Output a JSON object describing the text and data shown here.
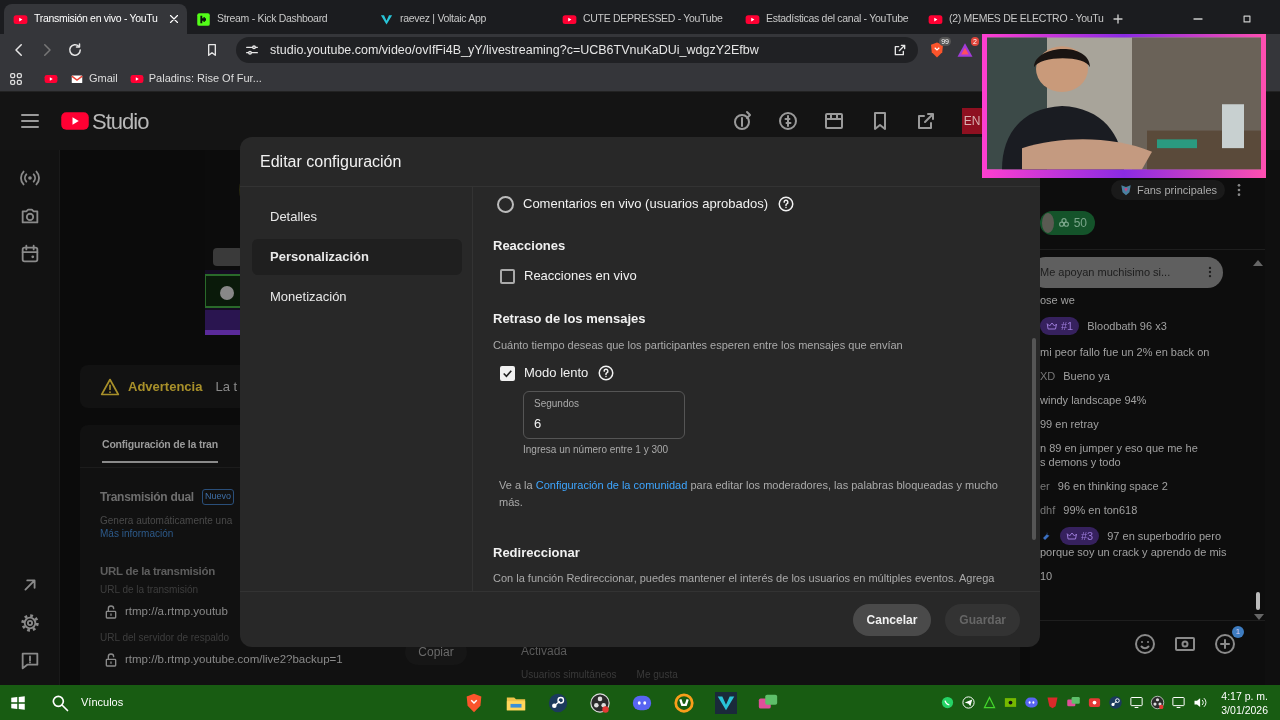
{
  "browser": {
    "tabs": [
      {
        "label": "Transmisión en vivo - YouTu",
        "selected": true
      },
      {
        "label": "Stream - Kick Dashboard",
        "selected": false
      },
      {
        "label": "raevez | Voltaic App",
        "selected": false
      },
      {
        "label": "CUTE DEPRESSED - YouTube",
        "selected": false
      },
      {
        "label": "Estadísticas del canal - YouTube",
        "selected": false
      },
      {
        "label": "(2) MEMES DE ELECTRO - YouTu",
        "selected": false
      }
    ],
    "forward_disabled": true,
    "url": "studio.youtube.com/video/ovIfFi4B_yY/livestreaming?c=UCB6TVnuKaDUi_wdgzY2Efbw",
    "extensions": [
      {
        "badge": "99"
      },
      {
        "badge": "2"
      }
    ],
    "bookmarks": [
      {
        "label": "Gmail"
      },
      {
        "label": "Paladins: Rise Of Fur..."
      }
    ]
  },
  "studio": {
    "logo": "Studio",
    "language_badge": "EN",
    "warning": {
      "title": "Advertencia",
      "text": "La t"
    },
    "config": {
      "tab": "Configuración de la tran",
      "dual_title": "Transmisión dual",
      "dual_badge": "Nuevo",
      "dual_text": "Genera automáticamente una",
      "dual_link": "Más información",
      "url_heading": "URL de la transmisión",
      "fields": [
        {
          "label": "URL de la transmisión",
          "value": "rtmp://a.rtmp.youtub"
        },
        {
          "label": "URL del servidor de respaldo",
          "value": "rtmp://b.rtmp.youtube.com/live2?backup=1"
        }
      ],
      "copy_button": "Copiar",
      "status": "Activada",
      "stat_labels": [
        "Usuarios simultáneos",
        "Me gusta"
      ]
    }
  },
  "chat": {
    "top_fans": "Fans principales",
    "fan_count": "50",
    "pinned": "Me apoyan muchisimo si...",
    "action_badge": "1",
    "messages": [
      {
        "lines": [
          "ose we"
        ],
        "moderator": false
      },
      {
        "badge": "#1",
        "lines": [
          "Bloodbath 96 x3"
        ],
        "moderator": false
      },
      {
        "lines": [
          "mi peor fallo fue un 2% en back on"
        ],
        "moderator": false
      },
      {
        "author": "XD",
        "lines": [
          "Bueno ya"
        ],
        "moderator": false
      },
      {
        "lines": [
          "windy landscape 94%"
        ],
        "moderator": false
      },
      {
        "lines": [
          "99 en retray"
        ],
        "moderator": false
      },
      {
        "lines": [
          "n 89 en jumper y eso que me he",
          "s demons y todo"
        ],
        "moderator": false
      },
      {
        "author": "er",
        "lines": [
          "96 en thinking space 2"
        ],
        "moderator": false
      },
      {
        "author": "dhf",
        "lines": [
          "99% en ton618"
        ],
        "moderator": false
      },
      {
        "badge": "#3",
        "lines": [
          "97 en superbodrio pero",
          "porque soy un crack y aprendo de mis"
        ],
        "moderator": true
      },
      {
        "lines": [
          "10"
        ],
        "moderator": false
      }
    ]
  },
  "modal": {
    "title": "Editar configuración",
    "nav": [
      {
        "label": "Detalles",
        "selected": false
      },
      {
        "label": "Personalización",
        "selected": true
      },
      {
        "label": "Monetización",
        "selected": false
      }
    ],
    "settings": [
      {
        "kind": "radio",
        "label": "Comentarios en vivo (usuarios aprobados)",
        "selected": false,
        "help": true
      },
      {
        "kind": "heading",
        "label": "Reacciones"
      },
      {
        "kind": "checkbox",
        "label": "Reacciones en vivo",
        "checked": false,
        "help": false
      },
      {
        "kind": "heading",
        "label": "Retraso de los mensajes"
      },
      {
        "kind": "text",
        "label": "Cuánto tiempo deseas que los participantes esperen entre los mensajes que envían"
      },
      {
        "kind": "checkbox",
        "label": "Modo lento",
        "checked": true,
        "help": true
      },
      {
        "kind": "number_field",
        "label": "Segundos",
        "value": "6",
        "hint": "Ingresa un número entre 1 y 300"
      },
      {
        "kind": "note",
        "before": "Ve a la",
        "link": "Configuración de la comunidad",
        "after": "para editar los moderadores, las palabras bloqueadas y mucho más."
      },
      {
        "kind": "heading",
        "label": "Redireccionar"
      },
      {
        "kind": "text",
        "label": "Con la función Redireccionar, puedes mantener el interés de los usuarios en múltiples eventos. Agrega"
      }
    ],
    "buttons": [
      {
        "label": "Cancelar",
        "disabled": false
      },
      {
        "label": "Guardar",
        "disabled": true
      }
    ]
  },
  "taskbar": {
    "search": "Vínculos",
    "time": "4:17 p. m.",
    "date": "3/01/2026"
  }
}
